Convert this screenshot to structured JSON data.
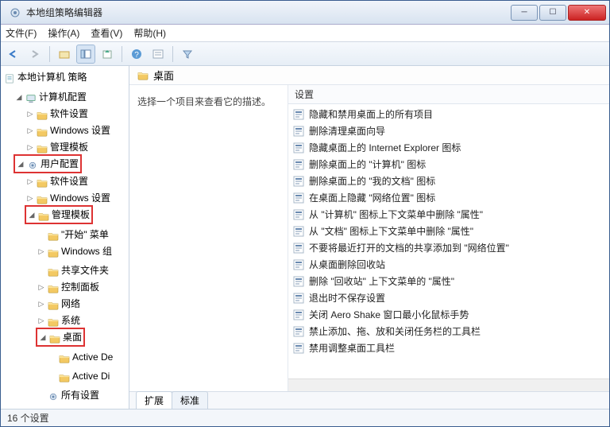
{
  "window": {
    "title": "本地组策略编辑器"
  },
  "menu": {
    "file": "文件(F)",
    "action": "操作(A)",
    "view": "查看(V)",
    "help": "帮助(H)"
  },
  "tree": {
    "root": "本地计算机 策略",
    "computer_cfg": "计算机配置",
    "c_soft": "软件设置",
    "c_win": "Windows 设置",
    "c_tmpl": "管理模板",
    "user_cfg": "用户配置",
    "u_soft": "软件设置",
    "u_win": "Windows 设置",
    "u_tmpl": "管理模板",
    "start_menu": "\"开始\" 菜单",
    "win_group": "Windows 组",
    "shared": "共享文件夹",
    "ctrl_panel": "控制面板",
    "network": "网络",
    "system": "系统",
    "desktop": "桌面",
    "ad_de": "Active De",
    "ad_di": "Active Di",
    "all_settings": "所有设置"
  },
  "main": {
    "header": "桌面",
    "desc": "选择一个项目来查看它的描述。",
    "col_header": "设置",
    "settings": [
      "隐藏和禁用桌面上的所有项目",
      "删除清理桌面向导",
      "隐藏桌面上的 Internet Explorer 图标",
      "删除桌面上的 \"计算机\" 图标",
      "删除桌面上的 \"我的文档\" 图标",
      "在桌面上隐藏 \"网络位置\" 图标",
      "从 \"计算机\" 图标上下文菜单中删除 \"属性\"",
      "从 \"文档\" 图标上下文菜单中删除 \"属性\"",
      "不要将最近打开的文档的共享添加到 \"网络位置\"",
      "从桌面删除回收站",
      "删除 \"回收站\" 上下文菜单的 \"属性\"",
      "退出时不保存设置",
      "关闭 Aero Shake 窗口最小化鼠标手势",
      "禁止添加、拖、放和关闭任务栏的工具栏",
      "禁用调整桌面工具栏"
    ]
  },
  "tabs": {
    "extended": "扩展",
    "standard": "标准"
  },
  "status": "16 个设置"
}
